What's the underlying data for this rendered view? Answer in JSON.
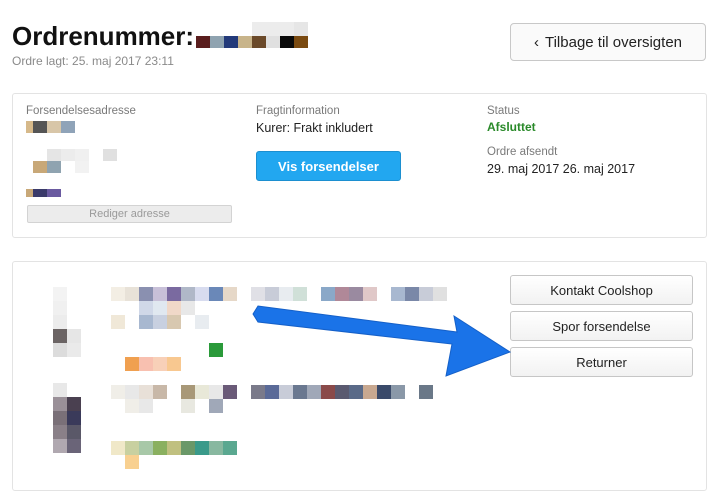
{
  "order": {
    "title": "Ordrenummer:",
    "placed": "Ordre lagt: 25. maj 2017 23:11"
  },
  "back_button": {
    "label": "Tilbage til oversigten",
    "icon": "chevron-left-icon"
  },
  "shipping_address": {
    "label": "Forsendelsesadresse",
    "edit_label": "Rediger adresse"
  },
  "freight": {
    "label": "Fragtinformation",
    "value": "Kurer: Frakt inkludert",
    "button_label": "Vis forsendelser"
  },
  "status": {
    "label": "Status",
    "value": "Afsluttet",
    "sent_label": "Ordre afsendt",
    "sent_value": "29. maj 2017 26. maj 2017"
  },
  "actions": {
    "contact": "Kontakt Coolshop",
    "track": "Spor forsendelse",
    "return": "Returner"
  },
  "colors": {
    "accent_blue": "#22a7f0",
    "status_green": "#2a8a2a",
    "arrow_blue": "#1a73e8"
  }
}
